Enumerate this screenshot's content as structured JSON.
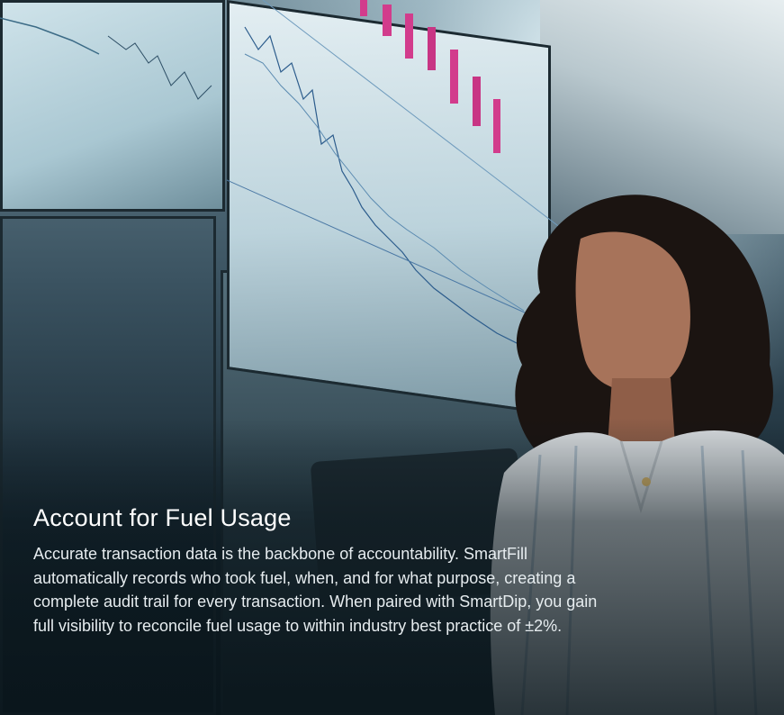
{
  "hero": {
    "title": "Account for Fuel Usage",
    "body": "Accurate transaction data is the backbone of accountability. SmartFill automatically records who took fuel, when, and for what purpose, creating a complete audit trail for every transaction. When paired with SmartDip, you gain full visibility to reconcile fuel usage to within industry best practice of ±2%.",
    "image": "woman looking up at monitor wall showing financial charts, holding a tablet"
  },
  "colors": {
    "title_text": "#ffffff",
    "body_text": "#e6ecef",
    "overlay": "#0a161c",
    "chart_pink": "#d23c8c",
    "chart_blue": "#3a6ea8"
  }
}
